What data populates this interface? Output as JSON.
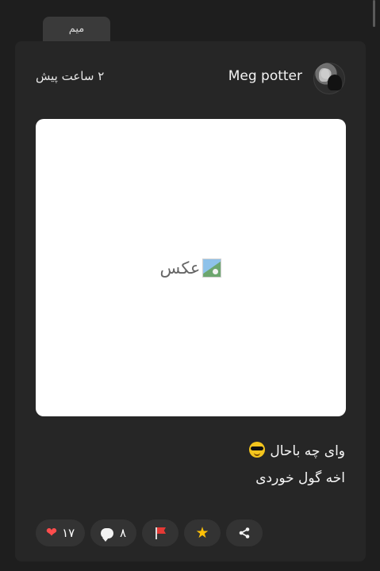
{
  "post": {
    "category": "میم",
    "author": {
      "name": "Meg potter",
      "avatar_icon": "profile-photo"
    },
    "time": "۲ ساعت پیش",
    "media": {
      "broken_alt": "عکس",
      "icon": "broken-image-icon"
    },
    "caption": {
      "line1": "وای چه باحال",
      "line1_emoji": "cool-sunglasses-emoji",
      "line2": "اخه گول خوردی"
    },
    "actions": {
      "likes": "۱۷",
      "comments": "۸",
      "like_icon": "heart-icon",
      "comment_icon": "comment-icon",
      "flag_icon": "flag-icon",
      "star_icon": "star-icon",
      "share_icon": "share-icon"
    },
    "colors": {
      "background": "#1e1e1e",
      "card": "#262626",
      "button": "#333333",
      "heart": "#ff4d4d",
      "flag": "#e53935",
      "star": "#ffc107"
    }
  }
}
